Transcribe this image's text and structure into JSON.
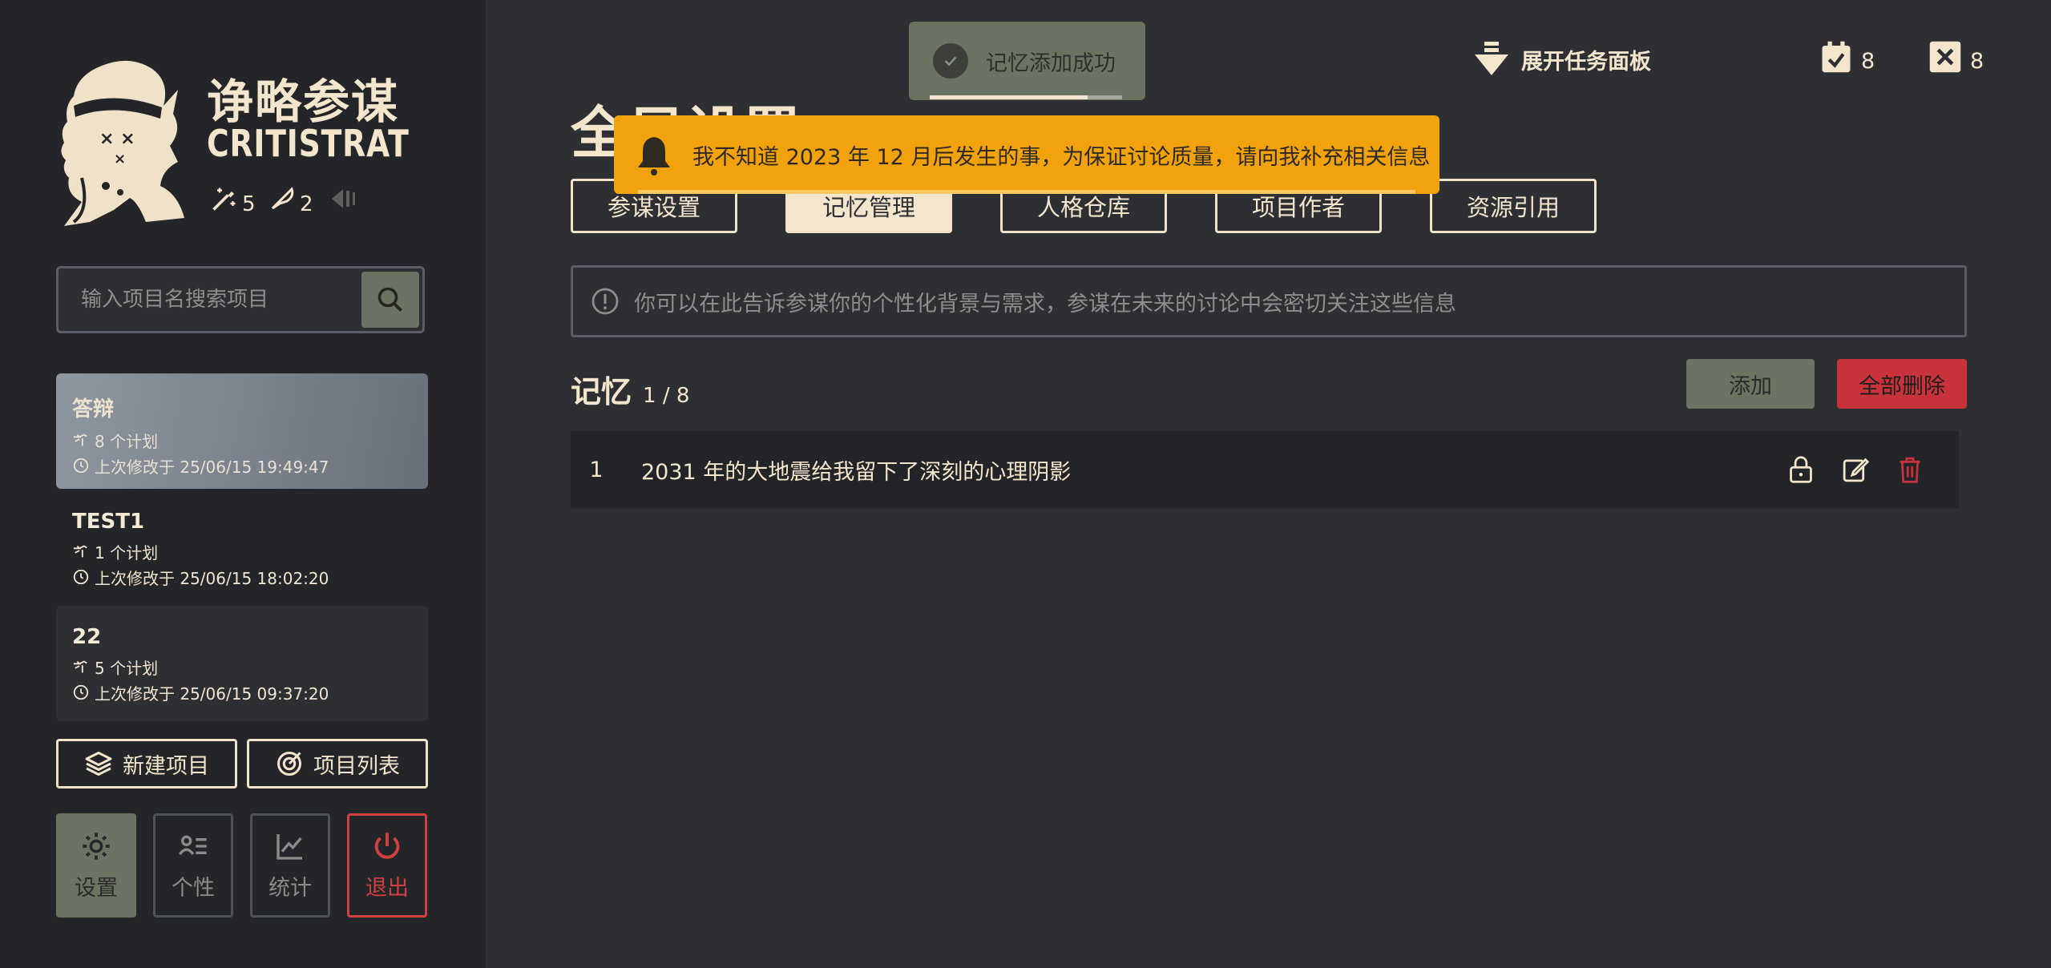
{
  "brand": {
    "title_cn": "诤略参谋",
    "title_en": "CRITISTRAT",
    "stat_wand": "5",
    "stat_pen": "2"
  },
  "search": {
    "placeholder": "输入项目名搜索项目"
  },
  "projects": [
    {
      "name": "答辩",
      "plans": "8 个计划",
      "modified": "上次修改于 25/06/15 19:49:47"
    },
    {
      "name": "TEST1",
      "plans": "1 个计划",
      "modified": "上次修改于 25/06/15 18:02:20"
    },
    {
      "name": "22",
      "plans": "5 个计划",
      "modified": "上次修改于 25/06/15 09:37:20"
    }
  ],
  "actions": {
    "new_project": "新建项目",
    "project_list": "项目列表"
  },
  "nav": {
    "settings": "设置",
    "persona": "个性",
    "stats": "统计",
    "exit": "退出"
  },
  "toast": {
    "message": "记忆添加成功",
    "progress": 0.82
  },
  "header": {
    "expand_tasks": "展开任务面板",
    "done_count": "8",
    "closed_count": "8"
  },
  "page": {
    "title": "全局设置"
  },
  "tabs": [
    "参谋设置",
    "记忆管理",
    "人格仓库",
    "项目作者",
    "资源引用"
  ],
  "active_tab": 1,
  "warning": {
    "message": "我不知道 2023 年 12 月后发生的事，为保证讨论质量，请向我补充相关信息"
  },
  "info": {
    "message": "你可以在此告诉参谋你的个性化背景与需求，参谋在未来的讨论中会密切关注这些信息"
  },
  "memory": {
    "title": "记忆",
    "count": "1 / 8",
    "add_label": "添加",
    "delete_all_label": "全部删除",
    "items": [
      {
        "index": "1",
        "text": "2031 年的大地震给我留下了深刻的心理阴影"
      }
    ]
  },
  "colors": {
    "accent_cream": "#f3e6cc",
    "sage": "#6b7463",
    "danger": "#c8323a",
    "warning": "#f2a20c",
    "sidebar_bg": "#242528",
    "main_bg": "#2e2f33"
  }
}
